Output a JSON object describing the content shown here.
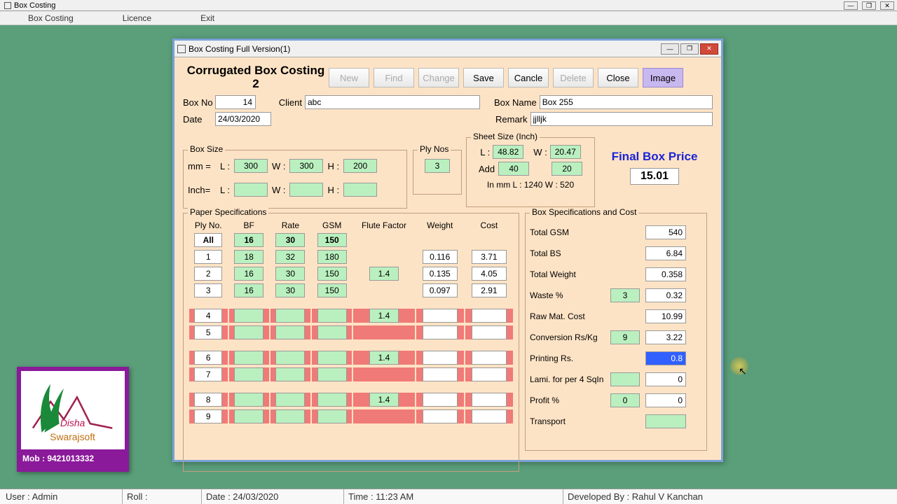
{
  "app": {
    "title": "Box Costing"
  },
  "menu": {
    "boxcosting": "Box Costing",
    "licence": "Licence",
    "exit": "Exit"
  },
  "inner": {
    "title": "Box Costing Full Version(1)"
  },
  "heading": "Corrugated Box Costing 2",
  "toolbar": {
    "new": "New",
    "find": "Find",
    "change": "Change",
    "save": "Save",
    "cancel": "Cancle",
    "delete": "Delete",
    "close": "Close",
    "image": "Image"
  },
  "top": {
    "boxno_lbl": "Box No",
    "boxno": "14",
    "client_lbl": "Client",
    "client": "abc",
    "boxname_lbl": "Box Name",
    "boxname": "Box 255",
    "date_lbl": "Date",
    "date": "24/03/2020",
    "remark_lbl": "Remark",
    "remark": "jjlljk"
  },
  "boxsize": {
    "legend": "Box Size",
    "mm": "mm =",
    "inch": "Inch=",
    "L": "L :",
    "W": "W :",
    "H": "H :",
    "mmL": "300",
    "mmW": "300",
    "mmH": "200",
    "inL": "",
    "inW": "",
    "inH": ""
  },
  "plynos": {
    "legend": "Ply Nos",
    "val": "3"
  },
  "sheet": {
    "legend": "Sheet Size (Inch)",
    "L": "L :",
    "W": "W :",
    "Add": "Add",
    "Lval": "48.82",
    "Wval": "20.47",
    "addL": "40",
    "addW": "20",
    "mmrow": "In mm L :  1240        W :  520"
  },
  "final": {
    "lbl": "Final Box Price",
    "val": "15.01"
  },
  "paper": {
    "legend": "Paper Specifications",
    "h": {
      "ply": "Ply No.",
      "bf": "BF",
      "rate": "Rate",
      "gsm": "GSM",
      "ff": "Flute Factor",
      "wt": "Weight",
      "cost": "Cost"
    },
    "all": "All",
    "allbf": "16",
    "allrate": "30",
    "allgsm": "150",
    "rows": [
      {
        "ply": "1",
        "bf": "18",
        "rate": "32",
        "gsm": "180",
        "ff": "",
        "wt": "0.116",
        "cost": "3.71",
        "red": false
      },
      {
        "ply": "2",
        "bf": "16",
        "rate": "30",
        "gsm": "150",
        "ff": "1.4",
        "wt": "0.135",
        "cost": "4.05",
        "red": false
      },
      {
        "ply": "3",
        "bf": "16",
        "rate": "30",
        "gsm": "150",
        "ff": "",
        "wt": "0.097",
        "cost": "2.91",
        "red": false
      },
      {
        "ply": "4",
        "bf": "",
        "rate": "",
        "gsm": "",
        "ff": "1.4",
        "wt": "",
        "cost": "",
        "red": true
      },
      {
        "ply": "5",
        "bf": "",
        "rate": "",
        "gsm": "",
        "ff": "",
        "wt": "",
        "cost": "",
        "red": true
      },
      {
        "ply": "6",
        "bf": "",
        "rate": "",
        "gsm": "",
        "ff": "1.4",
        "wt": "",
        "cost": "",
        "red": true
      },
      {
        "ply": "7",
        "bf": "",
        "rate": "",
        "gsm": "",
        "ff": "",
        "wt": "",
        "cost": "",
        "red": true
      },
      {
        "ply": "8",
        "bf": "",
        "rate": "",
        "gsm": "",
        "ff": "1.4",
        "wt": "",
        "cost": "",
        "red": true
      },
      {
        "ply": "9",
        "bf": "",
        "rate": "",
        "gsm": "",
        "ff": "",
        "wt": "",
        "cost": "",
        "red": true
      }
    ]
  },
  "spec": {
    "legend": "Box Specifications and Cost",
    "rows": [
      {
        "lbl": "Total GSM",
        "param": null,
        "val": "540"
      },
      {
        "lbl": "Total BS",
        "param": null,
        "val": "6.84"
      },
      {
        "lbl": "Total Weight",
        "param": null,
        "val": "0.358"
      },
      {
        "lbl": "Waste %",
        "param": "3",
        "val": "0.32"
      },
      {
        "lbl": "Raw Mat. Cost",
        "param": null,
        "val": "10.99"
      },
      {
        "lbl": "Conversion Rs/Kg",
        "param": "9",
        "val": "3.22"
      },
      {
        "lbl": "Printing Rs.",
        "param": null,
        "val": "0.8",
        "hl": true
      },
      {
        "lbl": "Lami. for per 4 SqIn",
        "param": "",
        "val": "0"
      },
      {
        "lbl": "Profit %",
        "param": "0",
        "val": "0"
      },
      {
        "lbl": "Transport",
        "param": null,
        "val": "",
        "greenval": true
      }
    ]
  },
  "logo": {
    "mob": "Mob : 9421013332"
  },
  "status": {
    "user": "User : Admin",
    "roll": "Roll :",
    "date": "Date : 24/03/2020",
    "time": "Time : 11:23 AM",
    "dev": "Developed By : Rahul V Kanchan"
  }
}
